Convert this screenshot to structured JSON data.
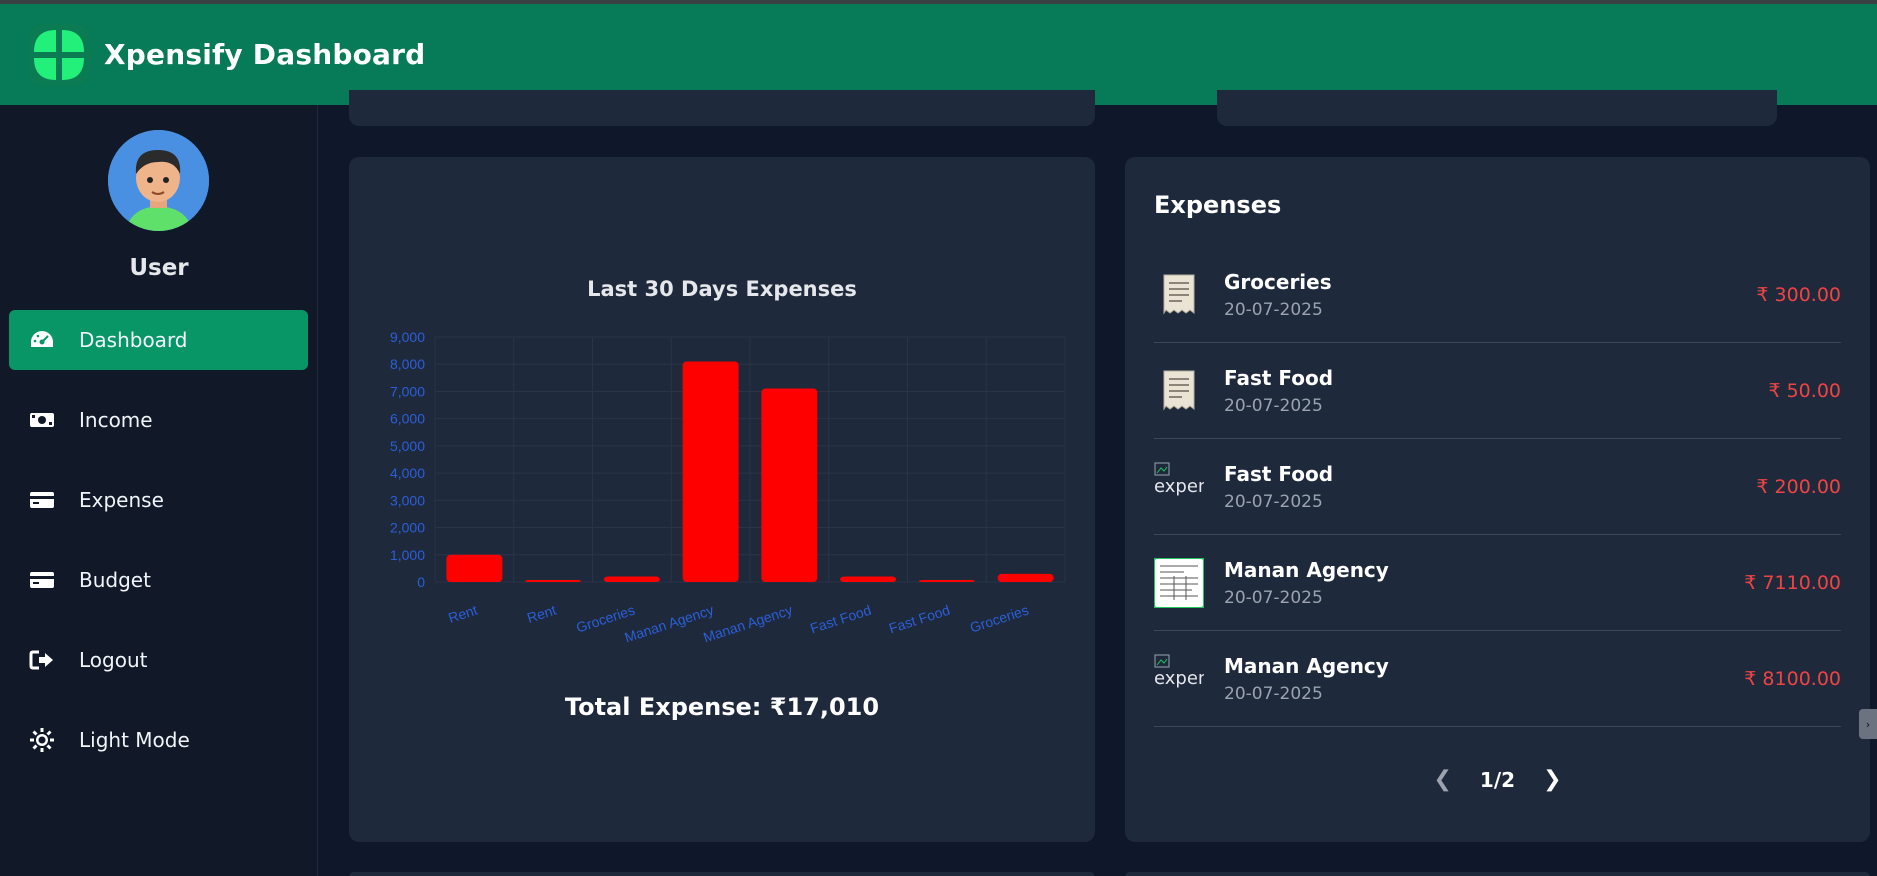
{
  "app": {
    "title": "Xpensify Dashboard"
  },
  "sidebar": {
    "username": "User",
    "items": [
      {
        "label": "Dashboard",
        "icon": "dashboard-icon",
        "active": true
      },
      {
        "label": "Income",
        "icon": "money-icon",
        "active": false
      },
      {
        "label": "Expense",
        "icon": "credit-card-icon",
        "active": false
      },
      {
        "label": "Budget",
        "icon": "credit-card-icon",
        "active": false
      },
      {
        "label": "Logout",
        "icon": "logout-icon",
        "active": false
      },
      {
        "label": "Light Mode",
        "icon": "sun-icon",
        "active": false
      }
    ]
  },
  "colors": {
    "header": "#077a57",
    "active_nav": "#089667",
    "bar": "#ff0000",
    "amount": "#ef4444",
    "axis_text": "#2b5fd9"
  },
  "chart_data": {
    "type": "bar",
    "title": "Last 30 Days Expenses",
    "categories": [
      "Rent",
      "Rent",
      "Groceries",
      "Manan Agency",
      "Manan Agency",
      "Fast Food",
      "Fast Food",
      "Groceries"
    ],
    "values": [
      1000,
      50,
      200,
      8100,
      7110,
      200,
      50,
      300
    ],
    "ylim": [
      0,
      9000
    ],
    "yticks": [
      "0",
      "1,000",
      "2,000",
      "3,000",
      "4,000",
      "5,000",
      "6,000",
      "7,000",
      "8,000",
      "9,000"
    ],
    "grid": true,
    "xlabel": "",
    "ylabel": ""
  },
  "total": {
    "text": "Total Expense: ₹17,010"
  },
  "expenses": {
    "title": "Expenses",
    "items": [
      {
        "name": "Groceries",
        "date": "20-07-2025",
        "amount": "₹ 300.00",
        "thumb": "receipt-icon",
        "alt": ""
      },
      {
        "name": "Fast Food",
        "date": "20-07-2025",
        "amount": "₹ 50.00",
        "thumb": "receipt-icon",
        "alt": ""
      },
      {
        "name": "Fast Food",
        "date": "20-07-2025",
        "amount": "₹ 200.00",
        "thumb": "broken-image",
        "alt": "expen"
      },
      {
        "name": "Manan Agency",
        "date": "20-07-2025",
        "amount": "₹ 7110.00",
        "thumb": "invoice-image",
        "alt": ""
      },
      {
        "name": "Manan Agency",
        "date": "20-07-2025",
        "amount": "₹ 8100.00",
        "thumb": "broken-image",
        "alt": "expen"
      }
    ],
    "pagination": {
      "label": "1/2"
    }
  }
}
